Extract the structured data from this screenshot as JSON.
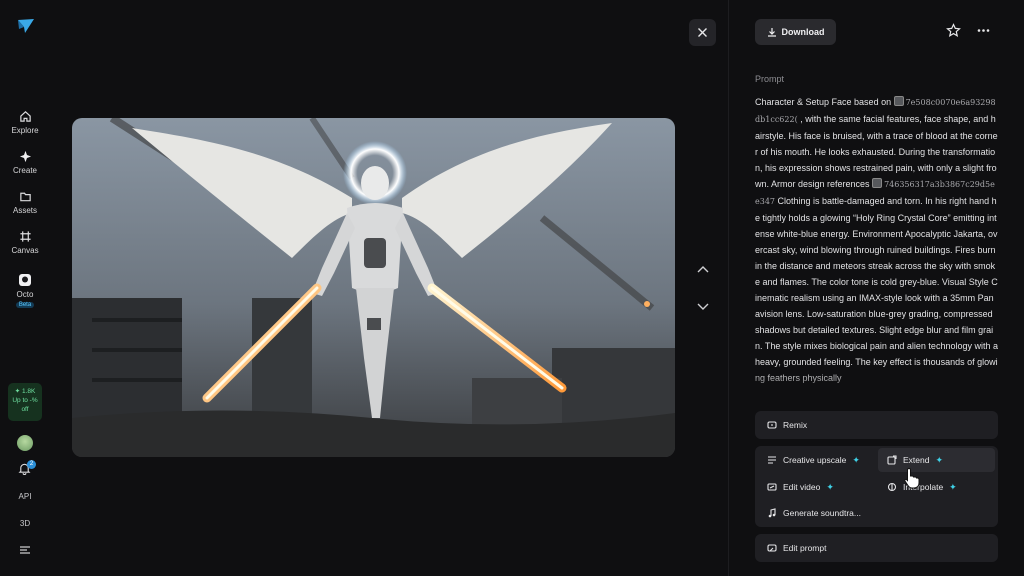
{
  "sidebar": {
    "items": [
      {
        "label": "Explore",
        "icon": "home-icon"
      },
      {
        "label": "Create",
        "icon": "sparkle-icon"
      },
      {
        "label": "Assets",
        "icon": "folder-icon"
      },
      {
        "label": "Canvas",
        "icon": "frame-icon"
      },
      {
        "label": "Octo",
        "icon": "octo-icon",
        "badge": "Beta"
      }
    ],
    "promo": {
      "credits": "✦ 1.8K",
      "line1": "Up to -%",
      "line2": "off"
    },
    "notifications_count": "2",
    "api_label": "API",
    "threed_label": "3D"
  },
  "toolbar": {
    "download_label": "Download"
  },
  "prompt": {
    "heading": "Prompt",
    "part1": "Character & Setup Face based on ",
    "ref1": "7e508c0070e6a93298db1cc622(",
    "part2": " , with the same facial features, face shape, and hairstyle. His face is bruised, with a trace of blood at the corner of his mouth. He looks exhausted. During the transformation, his expression shows restrained pain, with only a slight frown. Armor design references ",
    "ref2": "746356317a3b3867c29d5ee347",
    "part3": " Clothing is battle-damaged and torn. In his right hand he tightly holds a glowing “Holy Ring Crystal Core” emitting intense white-blue energy. Environment Apocalyptic Jakarta, overcast sky, wind blowing through ruined buildings. Fires burn in the distance and meteors streak across the sky with smoke and flames. The color tone is cold grey-blue. Visual Style Cinematic realism using an IMAX-style look with a 35mm Panavision lens. Low-saturation blue-grey grading, compressed shadows but detailed textures. Slight edge blur and film grain. The style mixes biological pain and alien technology with a heavy, grounded feeling. The key effect is thousands of glowing feathers physically"
  },
  "actions": {
    "remix": "Remix",
    "creative_upscale": "Creative upscale",
    "extend": "Extend",
    "edit_video": "Edit video",
    "interpolate": "Interpolate",
    "generate_soundtrack": "Generate soundtra...",
    "edit_prompt": "Edit prompt"
  },
  "colors": {
    "accent_sparkle": "#3fd2e8",
    "panel_bg": "#1f1f23",
    "page_bg": "#0f0f11"
  }
}
